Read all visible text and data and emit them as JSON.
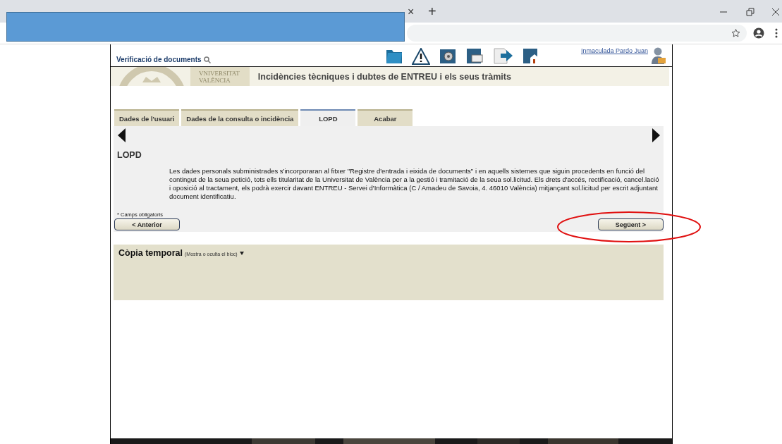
{
  "browser": {
    "new_tab": "+",
    "close_tab": "×"
  },
  "header": {
    "verify_link": "Verificació de documents",
    "user_link": "Inmaculada  Pardo Juan"
  },
  "banner": {
    "logo_top": "VNIVERSITAT",
    "logo_bottom": "VALÈNCIA",
    "title": "Incidències tècniques i dubtes de ENTREU i els seus tràmits"
  },
  "tabs": [
    {
      "label": "Dades de l'usuari",
      "selected": false
    },
    {
      "label": "Dades de la consulta o incidència",
      "selected": false
    },
    {
      "label": "LOPD",
      "selected": true
    },
    {
      "label": "Acabar",
      "selected": false
    }
  ],
  "section": {
    "heading": "LOPD",
    "text": "Les dades personals subministrades s'incorporaran al fitxer \"Registre d'entrada i eixida de documents\" i en aquells sistemes que siguin procedents en funció del contingut de la seua petició, tots ells titularitat de la Universitat de València per a la gestió i tramitació de la seua sol.licitud. Els drets d'accés, rectificació, cancel.lació i oposició al tractament, els podrà exercir davant ENTREU - Servei d'Informàtica (C / Amadeu de Savoia, 4. 46010 València) mitjançant sol.licitud per escrit adjuntant document identificatiu.",
    "required_note": "* Camps obligatoris",
    "prev_button": "< Anterior",
    "next_button": "Següent >"
  },
  "temp_copy": {
    "title": "Còpia temporal",
    "hint": "(Mostra o oculta el bloc)",
    "expanded": false
  }
}
